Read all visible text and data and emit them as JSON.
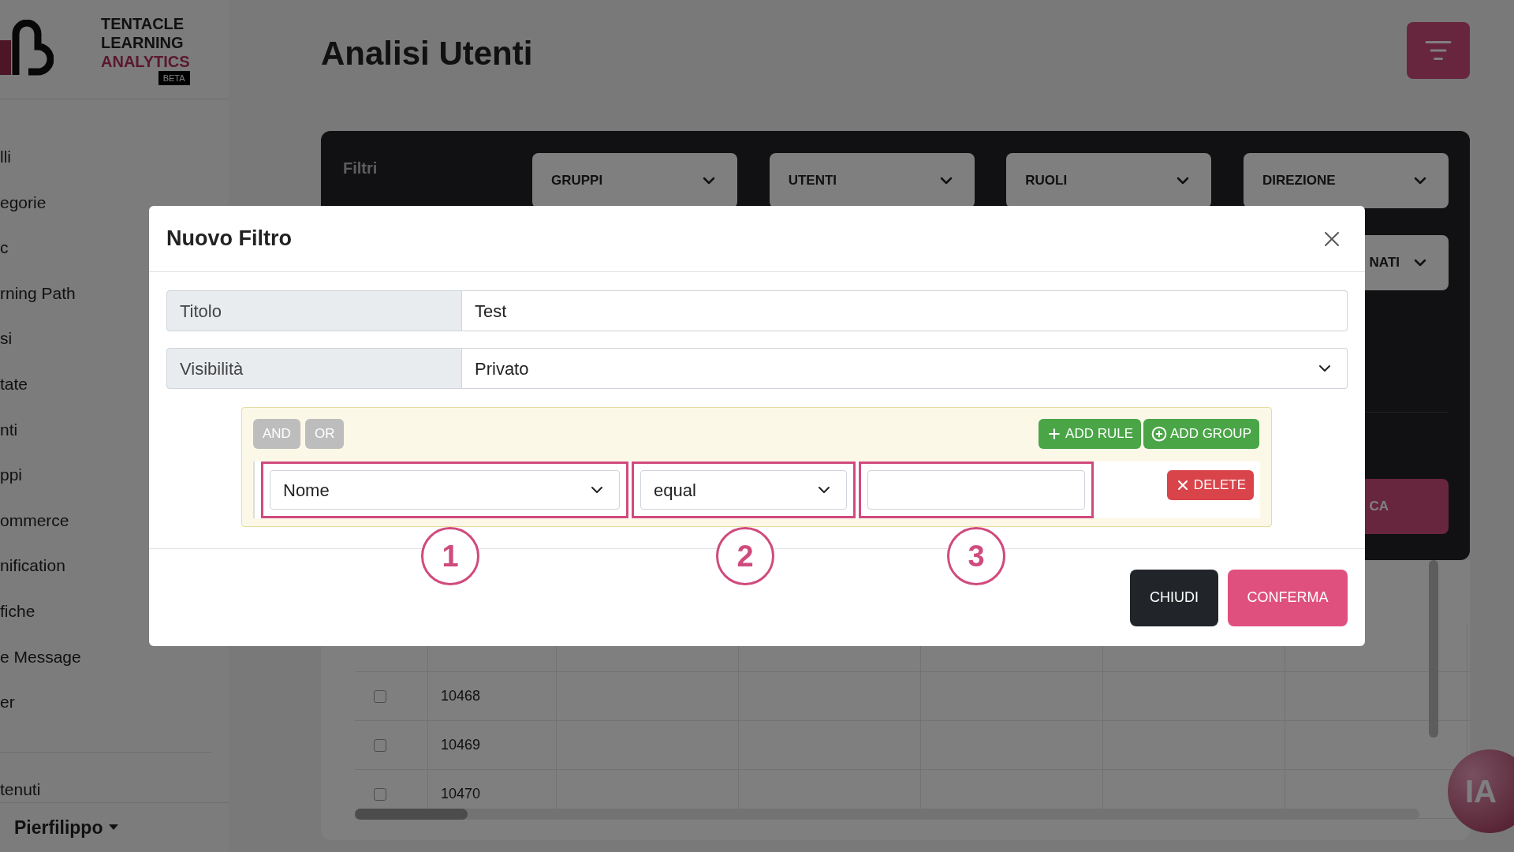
{
  "logo": {
    "lines": [
      "TENTACLE",
      "LEARNING"
    ],
    "accent": "ANALYTICS",
    "badge": "BETA"
  },
  "sidebar": {
    "items": [
      "lli",
      "egorie",
      "c",
      "rning Path",
      "si",
      "tate",
      "nti",
      "ppi",
      "ommerce",
      "nification",
      "fiche",
      "e Message",
      "er"
    ],
    "section_items": [
      "tenuti"
    ],
    "user": "Pierfilippo"
  },
  "page": {
    "title": "Analisi Utenti"
  },
  "filters": {
    "title": "Filtri",
    "dropdowns": [
      "GRUPPI",
      "UTENTI",
      "RUOLI",
      "DIREZIONE"
    ],
    "second_row": [
      "NATI"
    ],
    "action": "CA"
  },
  "table": {
    "rows": [
      {
        "id": "10468",
        "checked": false
      },
      {
        "id": "10469",
        "checked": false
      },
      {
        "id": "10470",
        "checked": false
      }
    ]
  },
  "assistant_badge": "IA",
  "dialog": {
    "title": "Nuovo Filtro",
    "fields": [
      {
        "label": "Titolo",
        "kind": "text",
        "value": "Test"
      },
      {
        "label": "Visibilità",
        "kind": "select",
        "value": "Privato"
      }
    ],
    "query": {
      "combinators": [
        "AND",
        "OR"
      ],
      "add_rule": "ADD RULE",
      "add_group": "ADD GROUP",
      "rules": [
        {
          "field": "Nome",
          "operator": "equal",
          "delete": "DELETE"
        }
      ]
    },
    "annotations": [
      "1",
      "2",
      "3"
    ],
    "buttons": [
      {
        "label": "CHIUDI",
        "kind": "secondary"
      },
      {
        "label": "CONFERMA",
        "kind": "primary"
      }
    ]
  }
}
